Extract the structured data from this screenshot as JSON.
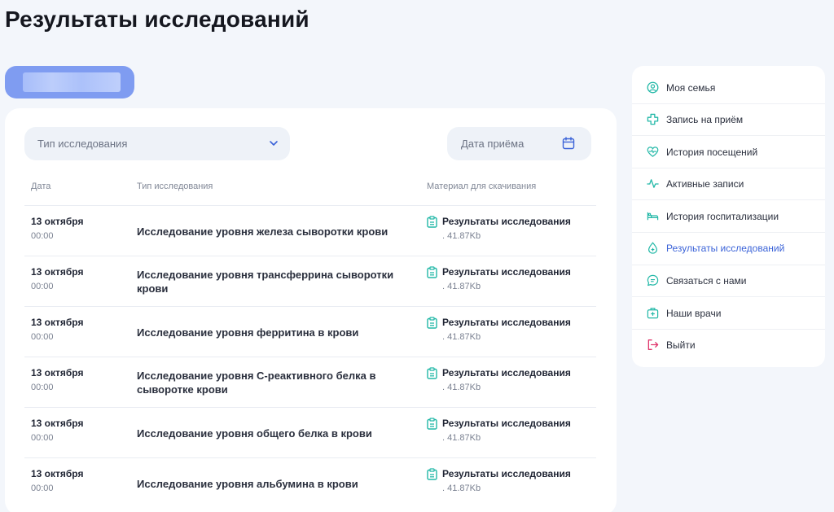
{
  "page_title": "Результаты исследований",
  "filters": {
    "type_placeholder": "Тип исследования",
    "date_placeholder": "Дата приёма"
  },
  "table": {
    "columns": [
      "Дата",
      "Тип исследования",
      "Материал для скачивания"
    ],
    "rows": [
      {
        "date": "13 октября",
        "time": "00:00",
        "type": "Исследование уровня железа сыворотки крови",
        "file_label": "Результаты исследования",
        "file_size": ". 41.87Kb"
      },
      {
        "date": "13 октября",
        "time": "00:00",
        "type": "Исследование уровня трансферрина сыворотки крови",
        "file_label": "Результаты исследования",
        "file_size": ". 41.87Kb"
      },
      {
        "date": "13 октября",
        "time": "00:00",
        "type": "Исследование уровня ферритина в крови",
        "file_label": "Результаты исследования",
        "file_size": ". 41.87Kb"
      },
      {
        "date": "13 октября",
        "time": "00:00",
        "type": "Исследование уровня С-реактивного белка в сыворотке крови",
        "file_label": "Результаты исследования",
        "file_size": ". 41.87Kb"
      },
      {
        "date": "13 октября",
        "time": "00:00",
        "type": "Исследование уровня общего белка в крови",
        "file_label": "Результаты исследования",
        "file_size": ". 41.87Kb"
      },
      {
        "date": "13 октября",
        "time": "00:00",
        "type": "Исследование уровня альбумина в крови",
        "file_label": "Результаты исследования",
        "file_size": ". 41.87Kb"
      }
    ]
  },
  "sidebar": {
    "items": [
      {
        "label": "Моя семья",
        "icon": "user-circle-icon"
      },
      {
        "label": "Запись на приём",
        "icon": "plus-cross-icon"
      },
      {
        "label": "История посещений",
        "icon": "heart-pulse-icon"
      },
      {
        "label": "Активные записи",
        "icon": "activity-icon"
      },
      {
        "label": "История госпитализации",
        "icon": "bed-icon"
      },
      {
        "label": "Результаты исследований",
        "icon": "drop-plus-icon"
      },
      {
        "label": "Связаться с нами",
        "icon": "chat-icon"
      },
      {
        "label": "Наши врачи",
        "icon": "medkit-icon"
      },
      {
        "label": "Выйти",
        "icon": "logout-icon"
      }
    ],
    "active_index": 5
  },
  "colors": {
    "accent": "#3b63d8",
    "teal": "#22b8a7",
    "logout": "#e0356b",
    "pill": "#7f9cf1"
  }
}
